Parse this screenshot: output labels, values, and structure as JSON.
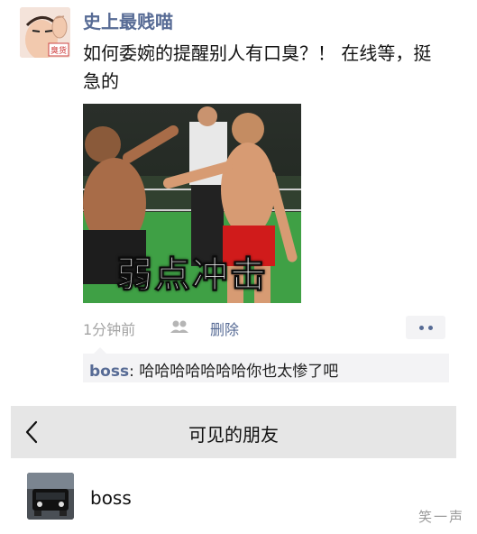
{
  "post": {
    "author": "史上最贱喵",
    "avatar_tag": "臭货",
    "text": "如何委婉的提醒别人有口臭？！ 在线等，挺急的",
    "image_caption": "弱点冲击",
    "time": "1分钟前",
    "delete_label": "删除",
    "people_icon": "people-icon",
    "more_icon": "more-dots-icon"
  },
  "comment": {
    "name": "boss",
    "separator": ": ",
    "text": "哈哈哈哈哈哈哈你也太惨了吧"
  },
  "visible_friends": {
    "title": "可见的朋友",
    "back_icon": "chevron-left-icon",
    "friends": [
      {
        "name": "boss"
      }
    ]
  },
  "watermark": "笑一声",
  "colors": {
    "link": "#576b95",
    "meta_gray": "#a3a3a3",
    "comment_bg": "#f3f3f5",
    "header_bg": "#e6e6e6"
  }
}
